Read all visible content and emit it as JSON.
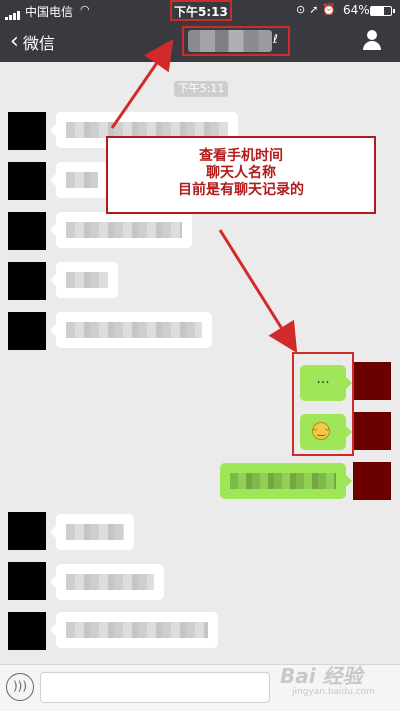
{
  "status_bar": {
    "carrier": "中国电信",
    "wifi_icon": "wifi-icon",
    "time": "下午5:13",
    "battery": "64%",
    "battery_level": 0.64
  },
  "nav": {
    "back_label": "微信",
    "back_icon": "chevron-left-icon",
    "profile_icon": "person-icon"
  },
  "chat": {
    "timestamp": "下午5:11",
    "sent_message_1": "...",
    "sent_message_2_icon": "smiley-emoji"
  },
  "annotation": {
    "line1": "查看手机时间",
    "line2": "聊天人名称",
    "line3": "目前是有聊天记录的",
    "color": "#b11b1b"
  },
  "watermark": {
    "logo_text": "Bai 经验",
    "url": "jingyan.baidu.com"
  },
  "colors": {
    "nav_bg": "#393a3f",
    "chat_bg": "#ebebeb",
    "sent_bubble": "#9fe658"
  }
}
